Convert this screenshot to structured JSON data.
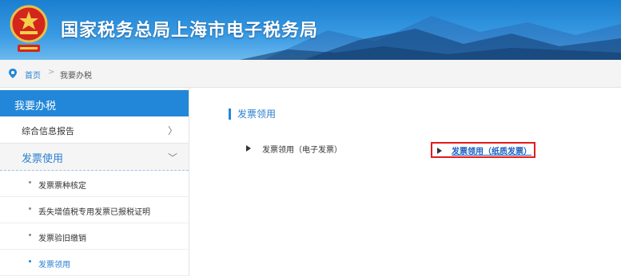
{
  "header": {
    "title": "国家税务总局上海市电子税务局",
    "emblem_icon": "national-emblem-icon",
    "colors": {
      "banner": "#2287d8",
      "mountain": "#1b4f8a"
    }
  },
  "breadcrumb": {
    "home": "首页",
    "separator": ">",
    "current": "我要办税"
  },
  "sidebar": {
    "header": "我要办税",
    "items": [
      {
        "label": "综合信息报告",
        "chevron": "〉"
      },
      {
        "label": "发票使用",
        "chevron": "﹀"
      }
    ],
    "subitems": [
      {
        "label": "发票票种核定"
      },
      {
        "label": "丢失增值税专用发票已报税证明"
      },
      {
        "label": "发票验旧缴销"
      },
      {
        "label": "发票领用",
        "active": true
      }
    ]
  },
  "main": {
    "title": "发票领用",
    "options": [
      {
        "label": "发票领用（电子发票）"
      },
      {
        "label": "发票领用（纸质发票）",
        "highlighted": true,
        "highlight_color": "#e31b1b"
      }
    ]
  }
}
